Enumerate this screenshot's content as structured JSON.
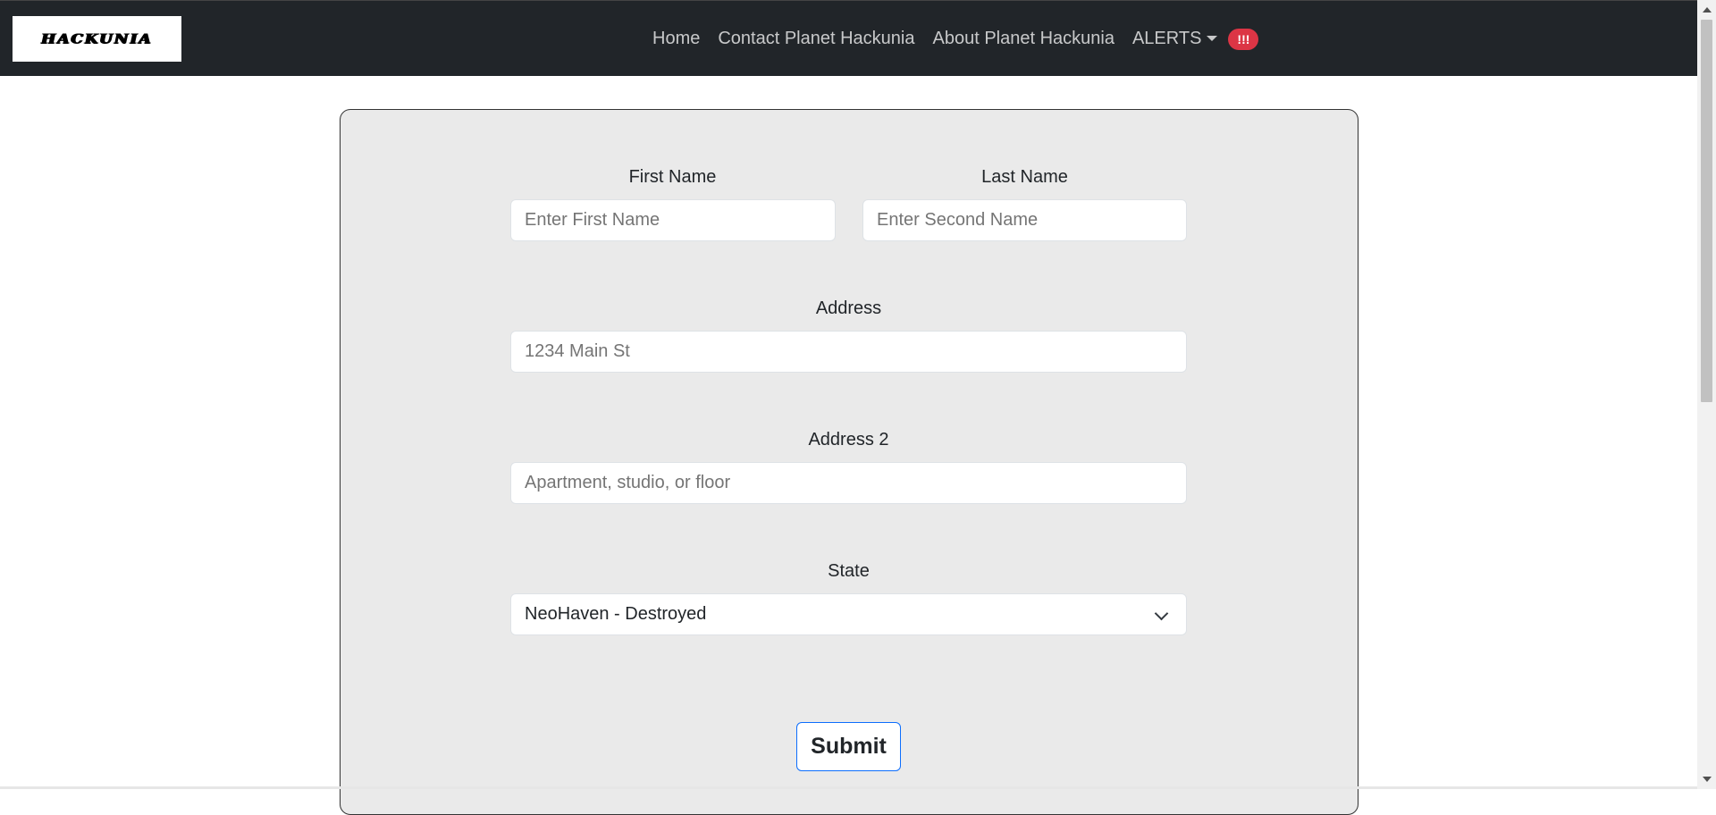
{
  "navbar": {
    "logo_text": "HACKUNIA",
    "links": [
      "Home",
      "Contact Planet Hackunia",
      "About Planet Hackunia"
    ],
    "alerts_label": "ALERTS",
    "alerts_badge": "!!!"
  },
  "form": {
    "first_name": {
      "label": "First Name",
      "placeholder": "Enter First Name"
    },
    "last_name": {
      "label": "Last Name",
      "placeholder": "Enter Second Name"
    },
    "address": {
      "label": "Address",
      "placeholder": "1234 Main St"
    },
    "address2": {
      "label": "Address 2",
      "placeholder": "Apartment, studio, or floor"
    },
    "state": {
      "label": "State",
      "selected": "NeoHaven - Destroyed"
    },
    "submit_label": "Submit"
  },
  "colors": {
    "navbar_bg": "#212529",
    "card_bg": "#eaeaea",
    "badge_bg": "#dc3545",
    "submit_border": "#0d6efd"
  }
}
